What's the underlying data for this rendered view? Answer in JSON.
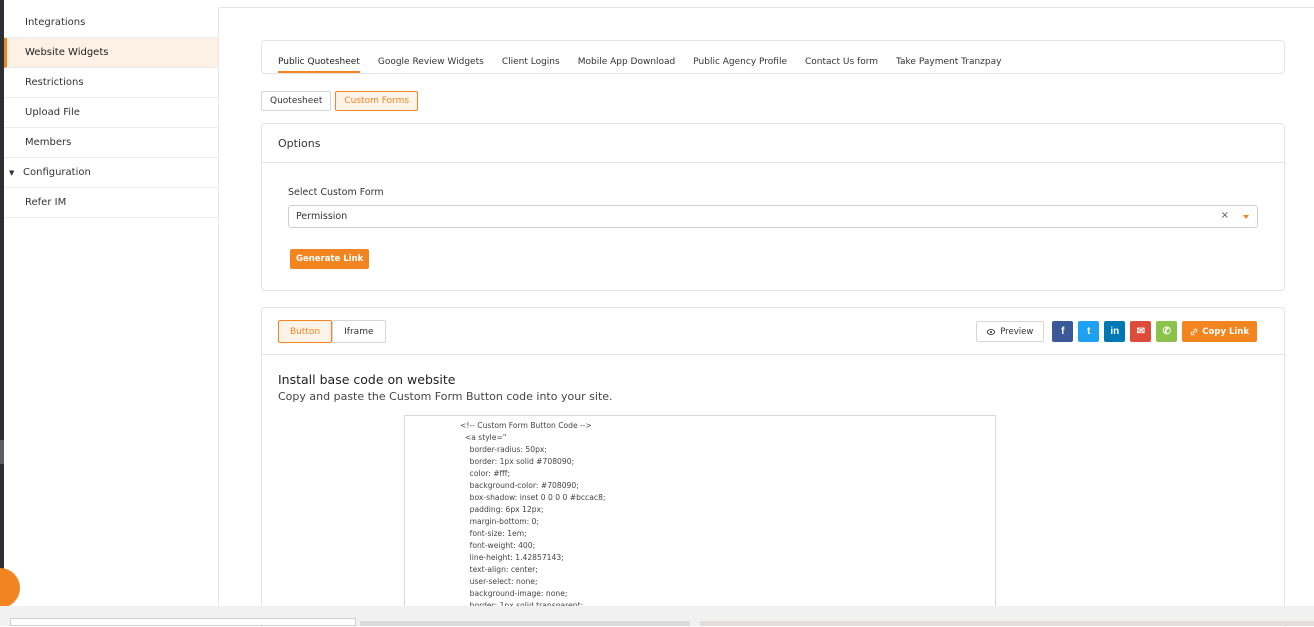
{
  "sidebar": {
    "items": [
      {
        "label": "Integrations",
        "active": false
      },
      {
        "label": "Website Widgets",
        "active": true
      },
      {
        "label": "Restrictions",
        "active": false
      },
      {
        "label": "Upload File",
        "active": false
      },
      {
        "label": "Members",
        "active": false
      },
      {
        "label": "Configuration",
        "active": false
      },
      {
        "label": "Refer IM",
        "active": false
      }
    ]
  },
  "tabs": [
    "Public Quotesheet",
    "Google Review Widgets",
    "Client Logins",
    "Mobile App Download",
    "Public Agency Profile",
    "Contact Us form",
    "Take Payment Tranzpay"
  ],
  "subtabs": [
    "Quotesheet",
    "Custom Forms"
  ],
  "options": {
    "title": "Options",
    "select_label": "Select Custom Form",
    "select_value": "Permission",
    "clear_symbol": "×",
    "generate_label": "Generate Link"
  },
  "install": {
    "tabs": [
      "Button",
      "Iframe"
    ],
    "preview_label": "Preview",
    "copy_label": "Copy Link",
    "title": "Install base code on website",
    "subtitle": "Copy and paste the Custom Form Button code into your site.",
    "code_lines": [
      "<!-- Custom Form Button Code -->",
      "  <a style=\"",
      "    border-radius: 50px;",
      "    border: 1px solid #708090;",
      "    color: #fff;",
      "    background-color: #708090;",
      "    box-shadow: inset 0 0 0 0 #bccac8;",
      "    padding: 6px 12px;",
      "    margin-bottom: 0;",
      "    font-size: 1em;",
      "    font-weight: 400;",
      "    line-height: 1.42857143;",
      "    text-align: center;",
      "    user-select: none;",
      "    background-image: none;",
      "    border: 1px solid transparent;"
    ]
  },
  "share": {
    "facebook": "f",
    "twitter": "t",
    "linkedin": "in",
    "email": "✉",
    "whatsapp": "✆"
  },
  "colors": {
    "accent": "#f2851f",
    "facebook": "#3b5998",
    "twitter": "#1da1f2",
    "linkedin": "#0077b5",
    "email": "#dd4b39",
    "whatsapp": "#8bc34a"
  }
}
